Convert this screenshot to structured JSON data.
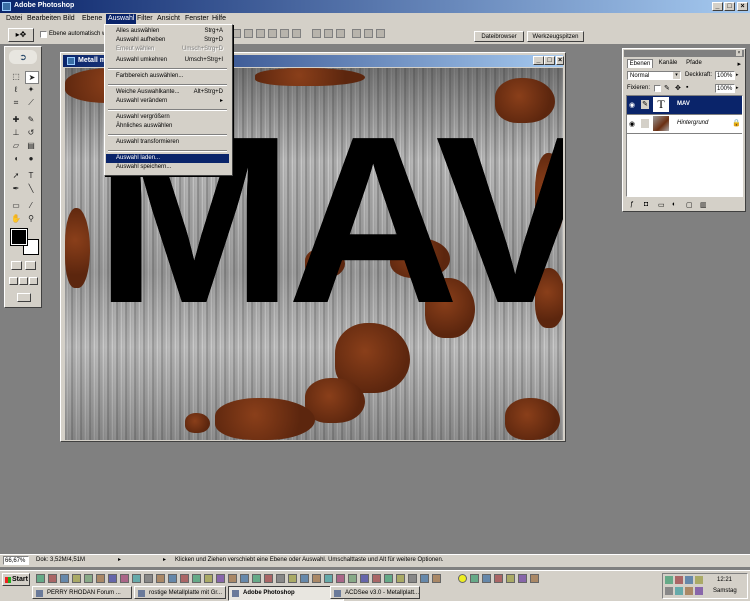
{
  "app": {
    "title": "Adobe Photoshop"
  },
  "menubar": [
    "Datei",
    "Bearbeiten",
    "Bild",
    "Ebene",
    "Auswahl",
    "Filter",
    "Ansicht",
    "Fenster",
    "Hilfe"
  ],
  "options": {
    "auto_select_label": "Ebene automatisch w",
    "tab_file_browser": "Dateibrowser",
    "tab_tool_presets": "Werkzeugspitzen"
  },
  "dropdown": {
    "items": [
      {
        "label": "Alles auswählen",
        "shortcut": "Strg+A",
        "disabled": false
      },
      {
        "label": "Auswahl aufheben",
        "shortcut": "Strg+D",
        "disabled": false
      },
      {
        "label": "Erneut wählen",
        "shortcut": "Umsch+Strg+D",
        "disabled": true
      },
      {
        "label": "Auswahl umkehren",
        "shortcut": "Umsch+Strg+I",
        "disabled": false
      },
      {
        "label": "Farbbereich auswählen...",
        "shortcut": "",
        "disabled": false
      },
      {
        "label": "Weiche Auswahlkante...",
        "shortcut": "Alt+Strg+D",
        "disabled": false
      },
      {
        "label": "Auswahl verändern",
        "shortcut": "",
        "disabled": false,
        "submenu": "▸"
      },
      {
        "label": "Auswahl vergrößern",
        "shortcut": "",
        "disabled": false
      },
      {
        "label": "Ähnliches auswählen",
        "shortcut": "",
        "disabled": false
      },
      {
        "label": "Auswahl transformieren",
        "shortcut": "",
        "disabled": false
      },
      {
        "label": "Auswahl laden...",
        "shortcut": "",
        "disabled": false,
        "selected": true
      },
      {
        "label": "Auswahl speichern...",
        "shortcut": "",
        "disabled": false
      }
    ]
  },
  "document": {
    "title": "Metall mi",
    "text": "MAV"
  },
  "layers_panel": {
    "tabs": [
      "Ebenen",
      "Kanäle",
      "Pfade"
    ],
    "blend_mode": "Normal",
    "opacity_label": "Deckkraft:",
    "opacity_value": "100%",
    "lock_label": "Fixieren:",
    "fill_value": "100%",
    "layers": [
      {
        "name": "MAV",
        "type_glyph": "T",
        "selected": true
      },
      {
        "name": "Hintergrund",
        "type_glyph": "",
        "selected": false
      }
    ]
  },
  "statusbar": {
    "zoom": "66,67%",
    "doc_size": "Dok: 3,52M/4,51M",
    "hint": "Klicken und Ziehen verschiebt eine Ebene oder Auswahl. Umschalttaste und Alt für weitere Optionen."
  },
  "taskbar": {
    "start_label": "Start",
    "tasks": [
      {
        "label": "PERRY RHODAN Forum ...",
        "active": false
      },
      {
        "label": "rostige Metallplatte mit Gr...",
        "active": false
      },
      {
        "label": "Adobe Photoshop",
        "active": true
      },
      {
        "label": "ACDSee v3.0 - Metallplatt...",
        "active": false
      }
    ],
    "time": "12:21",
    "day": "Samstag"
  },
  "colors": {
    "titlebar": "#0a246a",
    "chrome": "#d4d0c8",
    "selection": "#0a246a",
    "rust": "#6b2f12"
  }
}
